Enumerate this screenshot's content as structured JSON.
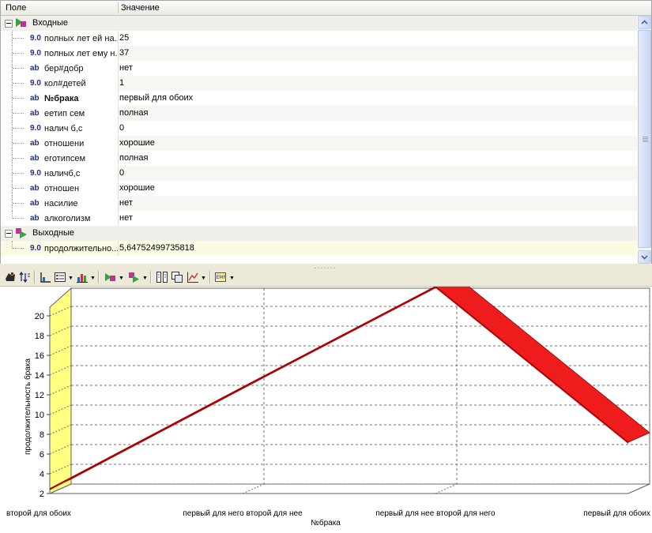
{
  "grid": {
    "col_field": "Поле",
    "col_value": "Значение",
    "groups": {
      "inputs": "Входные",
      "outputs": "Выходные"
    },
    "inputs": [
      {
        "type": "9.0",
        "name": "полных лет ей на...",
        "value": "25",
        "bold": false
      },
      {
        "type": "9.0",
        "name": "полных лет ему н...",
        "value": "37",
        "bold": false
      },
      {
        "type": "ab",
        "name": "бер#добр",
        "value": "нет",
        "bold": false
      },
      {
        "type": "9.0",
        "name": "кол#детей",
        "value": "1",
        "bold": false
      },
      {
        "type": "ab",
        "name": "№брака",
        "value": "первый для обоих",
        "bold": true
      },
      {
        "type": "ab",
        "name": "еетип сем",
        "value": "полная",
        "bold": false
      },
      {
        "type": "9.0",
        "name": "налич б,с",
        "value": "0",
        "bold": false
      },
      {
        "type": "ab",
        "name": "отношени",
        "value": "хорошие",
        "bold": false
      },
      {
        "type": "ab",
        "name": "еготипсем",
        "value": "полная",
        "bold": false
      },
      {
        "type": "9.0",
        "name": "наличб,с",
        "value": "0",
        "bold": false
      },
      {
        "type": "ab",
        "name": "отношен",
        "value": "хорошие",
        "bold": false
      },
      {
        "type": "ab",
        "name": "насилие",
        "value": "нет",
        "bold": false
      },
      {
        "type": "ab",
        "name": "алкоголизм",
        "value": "нет",
        "bold": false
      }
    ],
    "outputs": [
      {
        "type": "9.0",
        "name": "продолжительно...",
        "value": "5,64752499735818",
        "bold": false
      }
    ]
  },
  "toolbar": {
    "icons": [
      "stamp-icon",
      "sort-icon",
      "chart-axes-icon",
      "legend-icon",
      "bar-chart-icon",
      "input-node-icon",
      "output-node-icon",
      "grid-layout-icon",
      "copy-icon",
      "line-chart-icon",
      "export-emf-icon"
    ]
  },
  "chart_data": {
    "type": "line",
    "categories": [
      "второй для обоих",
      "первый для него второй для нее",
      "первый для нее второй для него",
      "первый для обоих"
    ],
    "series": [
      {
        "values": [
          2.5,
          12.8,
          23.0,
          7.2
        ]
      }
    ],
    "xlabel": "№брака",
    "ylabel": "продолжительность брака",
    "ylim": [
      2,
      22
    ],
    "yticks": [
      "2",
      "4",
      "6",
      "8",
      "10",
      "12",
      "14",
      "16",
      "18",
      "20"
    ],
    "grid": true,
    "legend": "none",
    "colors": {
      "series": "#ee1c1c",
      "wall": "#ffff80"
    }
  }
}
